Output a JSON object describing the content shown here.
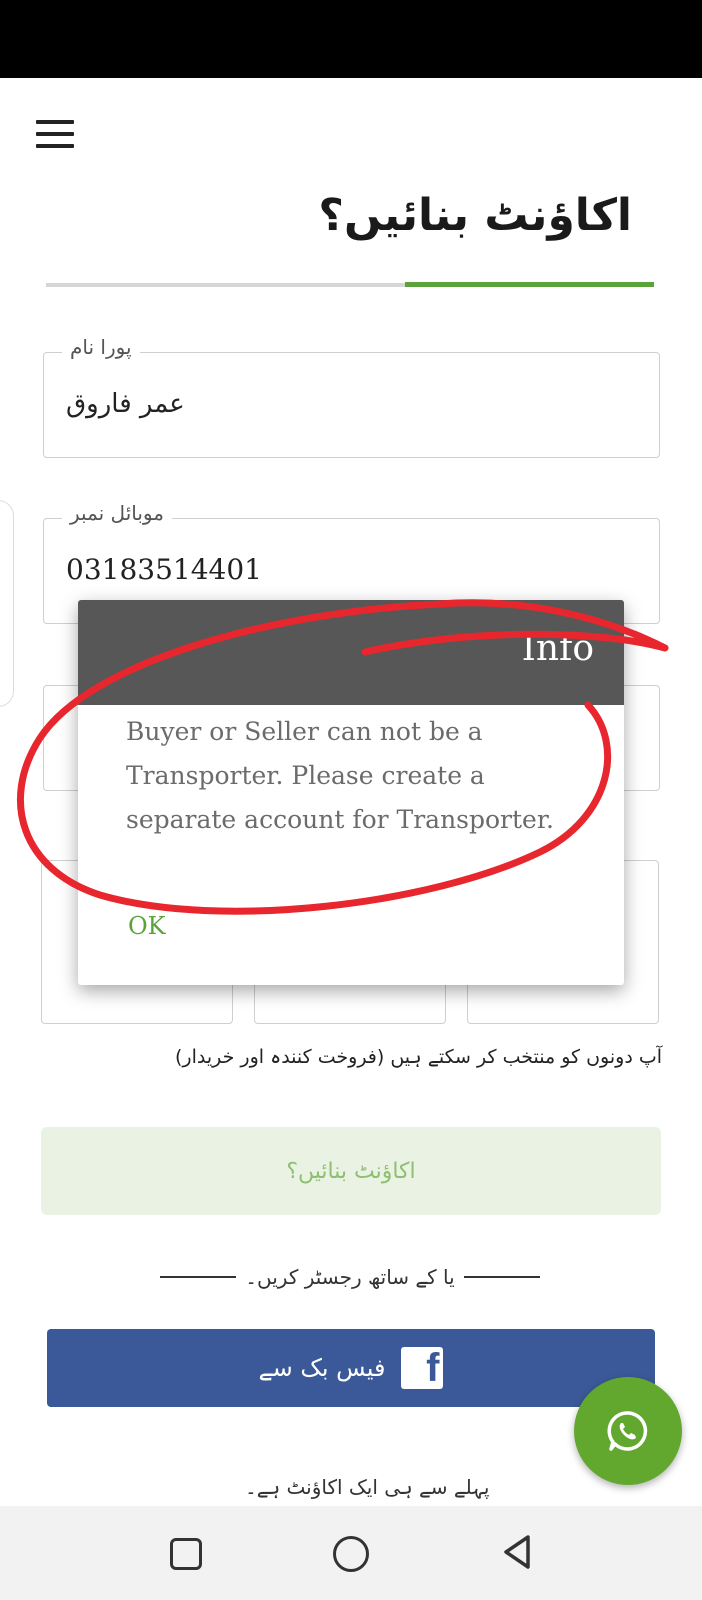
{
  "header": {
    "menu_icon": "hamburger-menu-icon",
    "title": "اکاؤنٹ بنائیں؟",
    "progress": 0.41
  },
  "form": {
    "full_name": {
      "label": "پورا نام",
      "value": "عمر فاروق"
    },
    "mobile": {
      "label": "موبائل نمبر",
      "value": "03183514401"
    },
    "role_hint": "آپ دونوں کو منتخب کر سکتے ہیں (فروخت کنندہ اور خریدار)",
    "create_button": "اکاؤنٹ بنائیں؟",
    "divider_text": "یا کے ساتھ رجسٹر کریں۔",
    "facebook_button": "فیس بک سے",
    "already_account": "پہلے سے ہی ایک اکاؤنٹ ہے۔"
  },
  "dialog": {
    "title": "Info",
    "message": "Buyer or Seller can not be a Transporter. Please create a separate account for Transporter.",
    "ok_label": "OK"
  },
  "colors": {
    "accent_green": "#5aa33b",
    "facebook_blue": "#3b5998",
    "whatsapp_green": "#62a82f",
    "dialog_header": "#575757",
    "annotation_red": "#e8262e"
  },
  "icons": {
    "facebook": "facebook-icon",
    "whatsapp": "whatsapp-icon",
    "nav_recent": "recent-apps-icon",
    "nav_home": "home-icon",
    "nav_back": "back-icon"
  }
}
